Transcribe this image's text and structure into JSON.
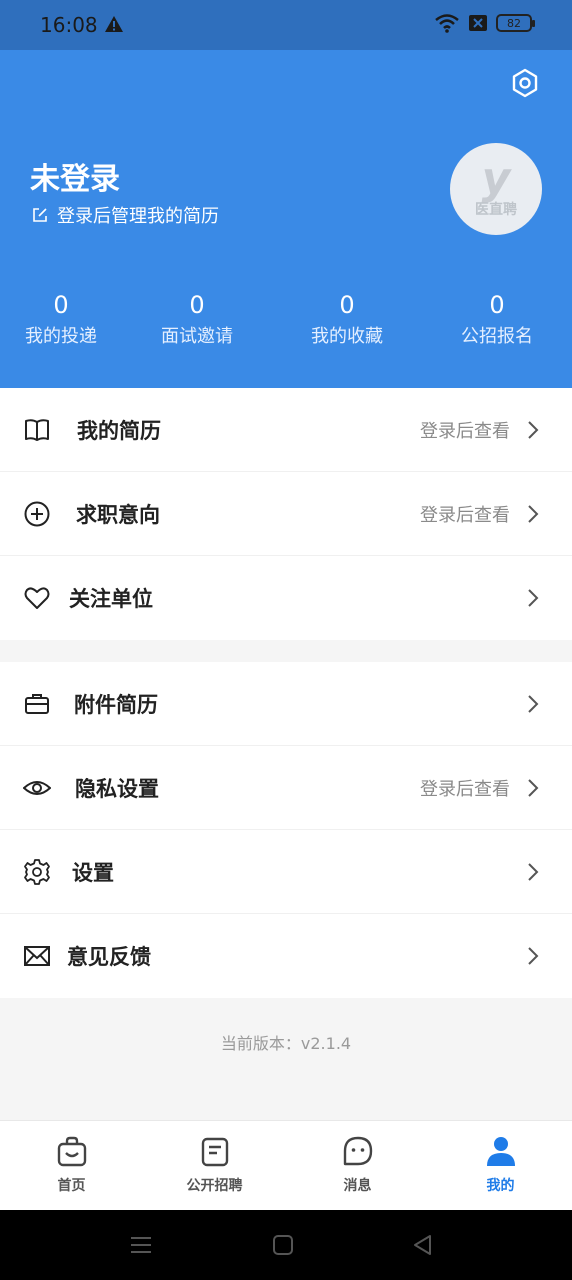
{
  "status_bar": {
    "time": "16:08",
    "battery": "82"
  },
  "header": {
    "user_name": "未登录",
    "login_hint": "登录后管理我的简历",
    "avatar_letter": "y",
    "avatar_text": "医直聘",
    "stats": [
      {
        "value": "0",
        "label": "我的投递"
      },
      {
        "value": "0",
        "label": "面试邀请"
      },
      {
        "value": "0",
        "label": "我的收藏"
      },
      {
        "value": "0",
        "label": "公招报名"
      }
    ]
  },
  "menu_group_1": [
    {
      "label": "我的简历",
      "value": "登录后查看",
      "icon": "book-icon"
    },
    {
      "label": "求职意向",
      "value": "登录后查看",
      "icon": "plus-circle-icon"
    },
    {
      "label": "关注单位",
      "value": "",
      "icon": "heart-icon"
    }
  ],
  "menu_group_2": [
    {
      "label": "附件简历",
      "value": "",
      "icon": "briefcase-icon"
    },
    {
      "label": "隐私设置",
      "value": "登录后查看",
      "icon": "eye-icon"
    },
    {
      "label": "设置",
      "value": "",
      "icon": "gear-icon"
    },
    {
      "label": "意见反馈",
      "value": "",
      "icon": "envelope-icon"
    }
  ],
  "version": "当前版本：v2.1.4",
  "tabs": [
    {
      "label": "首页",
      "icon": "home-bag-icon"
    },
    {
      "label": "公开招聘",
      "icon": "document-icon"
    },
    {
      "label": "消息",
      "icon": "message-icon"
    },
    {
      "label": "我的",
      "icon": "user-icon",
      "active": true
    }
  ],
  "colors": {
    "primary": "#3a8ae6",
    "tab_active": "#1f7ce8"
  }
}
